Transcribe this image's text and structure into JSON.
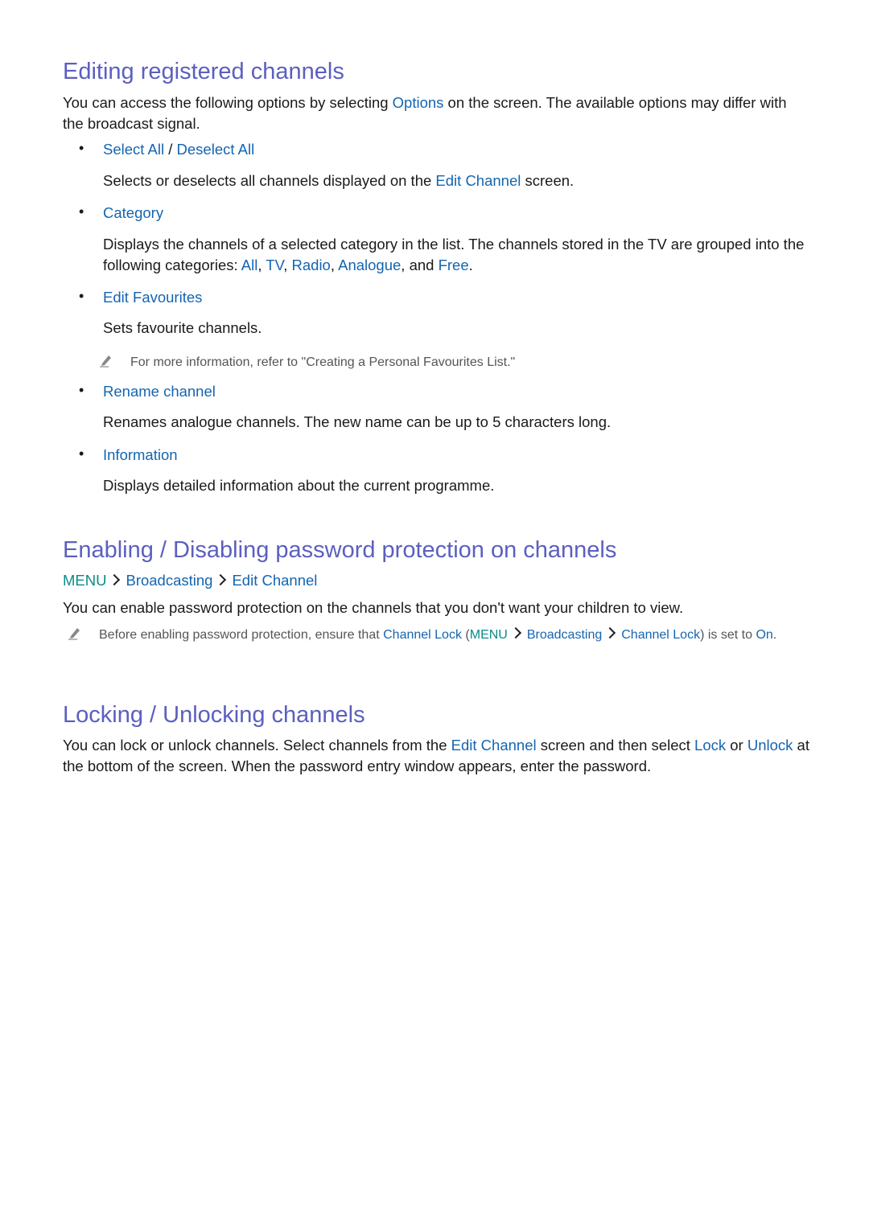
{
  "sections": [
    {
      "title": "Editing registered channels",
      "intro": [
        "You can access the following options by selecting ",
        "Options",
        " on the screen. The available options may differ with the broadcast signal."
      ],
      "items": [
        {
          "label_a": "Select All",
          "sep": " / ",
          "label_b": "Deselect All",
          "desc": [
            "Selects or deselects all channels displayed on the ",
            "Edit Channel",
            " screen."
          ]
        },
        {
          "label": "Category",
          "desc": [
            "Displays the channels of a selected category in the list. The channels stored in the TV are grouped into the following categories: ",
            "All",
            ", ",
            "TV",
            ", ",
            "Radio",
            ", ",
            "Analogue",
            ", and ",
            "Free",
            "."
          ]
        },
        {
          "label": "Edit Favourites",
          "desc": "Sets favourite channels.",
          "note": "For more information, refer to \"Creating a Personal Favourites List.\""
        },
        {
          "label": "Rename channel",
          "desc": "Renames analogue channels. The new name can be up to 5 characters long."
        },
        {
          "label": "Information",
          "desc": "Displays detailed information about the current programme."
        }
      ]
    },
    {
      "title": "Enabling / Disabling password protection on channels",
      "path": [
        "MENU",
        "Broadcasting",
        "Edit Channel"
      ],
      "body": "You can enable password protection on the channels that you don't want your children to view.",
      "note": [
        "Before enabling password protection, ensure that ",
        "Channel Lock",
        " (",
        "MENU",
        "Broadcasting",
        "Channel Lock",
        ") is set to ",
        "On",
        "."
      ]
    },
    {
      "title": "Locking / Unlocking channels",
      "body": [
        "You can lock or unlock channels. Select channels from the ",
        "Edit Channel",
        " screen and then select ",
        "Lock",
        " or ",
        "Unlock",
        " at the bottom of the screen. When the password entry window appears, enter the password."
      ]
    }
  ],
  "icons": {
    "note": "pencil-icon",
    "path_separator": "chevron-right-icon",
    "bullet": "bullet-dot"
  }
}
